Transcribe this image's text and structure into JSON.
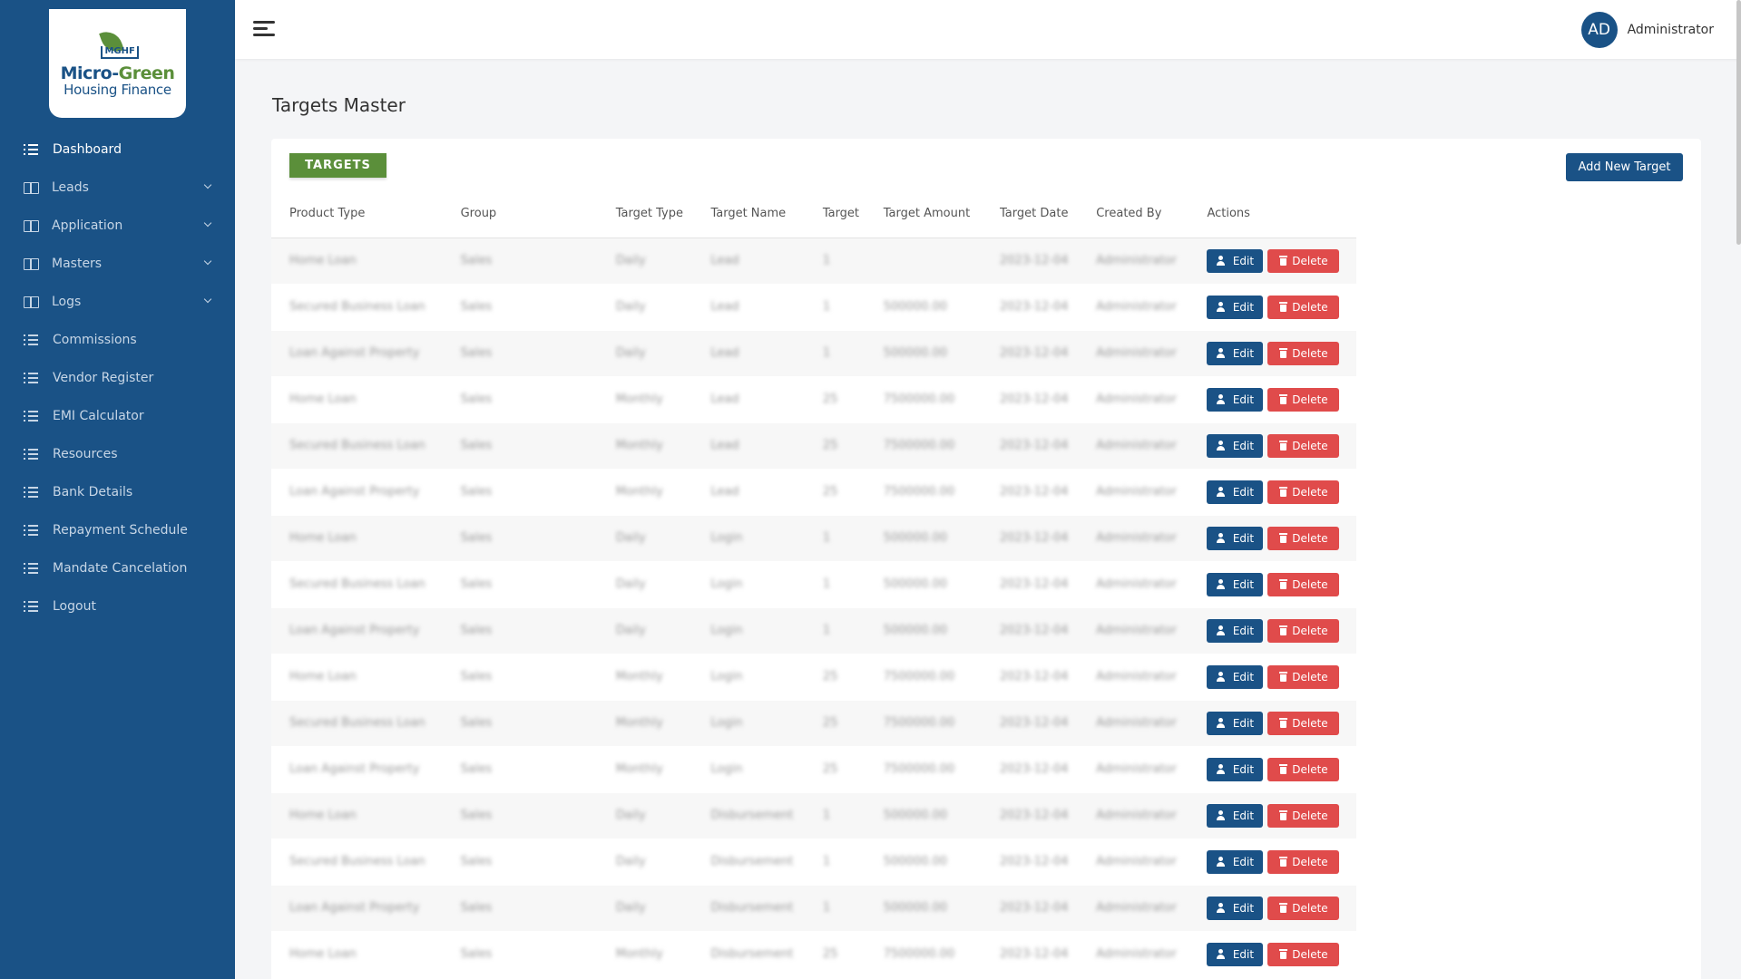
{
  "logo": {
    "word1": "Micro-",
    "word2": "Green",
    "line2": "Housing Finance",
    "badge": "MGHF"
  },
  "sidebar": {
    "items": [
      {
        "label": "Dashboard",
        "icon": "list-icon",
        "chevron": false
      },
      {
        "label": "Leads",
        "icon": "book-icon",
        "chevron": true
      },
      {
        "label": "Application",
        "icon": "book-icon",
        "chevron": true
      },
      {
        "label": "Masters",
        "icon": "book-icon",
        "chevron": true
      },
      {
        "label": "Logs",
        "icon": "book-icon",
        "chevron": true
      },
      {
        "label": "Commissions",
        "icon": "list-icon",
        "chevron": false
      },
      {
        "label": "Vendor Register",
        "icon": "list-icon",
        "chevron": false
      },
      {
        "label": "EMI Calculator",
        "icon": "list-icon",
        "chevron": false
      },
      {
        "label": "Resources",
        "icon": "list-icon",
        "chevron": false
      },
      {
        "label": "Bank Details",
        "icon": "list-icon",
        "chevron": false
      },
      {
        "label": "Repayment Schedule",
        "icon": "list-icon",
        "chevron": false
      },
      {
        "label": "Mandate Cancelation",
        "icon": "list-icon",
        "chevron": false
      },
      {
        "label": "Logout",
        "icon": "list-icon",
        "chevron": false
      }
    ]
  },
  "header": {
    "avatar_initials": "AD",
    "user_name": "Administrator"
  },
  "page": {
    "title": "Targets Master",
    "tag": "TARGETS",
    "add_button": "Add New Target"
  },
  "table": {
    "columns": [
      "Product Type",
      "Group",
      "Target Type",
      "Target Name",
      "Target",
      "Target Amount",
      "Target Date",
      "Created By",
      "Actions"
    ],
    "edit_label": "Edit",
    "delete_label": "Delete",
    "rows": [
      [
        "Home Loan",
        "Sales",
        "Daily",
        "Lead",
        "1",
        "",
        "2023-12-04",
        "Administrator"
      ],
      [
        "Secured Business Loan",
        "Sales",
        "Daily",
        "Lead",
        "1",
        "500000.00",
        "2023-12-04",
        "Administrator"
      ],
      [
        "Loan Against Property",
        "Sales",
        "Daily",
        "Lead",
        "1",
        "500000.00",
        "2023-12-04",
        "Administrator"
      ],
      [
        "Home Loan",
        "Sales",
        "Monthly",
        "Lead",
        "25",
        "7500000.00",
        "2023-12-04",
        "Administrator"
      ],
      [
        "Secured Business Loan",
        "Sales",
        "Monthly",
        "Lead",
        "25",
        "7500000.00",
        "2023-12-04",
        "Administrator"
      ],
      [
        "Loan Against Property",
        "Sales",
        "Monthly",
        "Lead",
        "25",
        "7500000.00",
        "2023-12-04",
        "Administrator"
      ],
      [
        "Home Loan",
        "Sales",
        "Daily",
        "Login",
        "1",
        "500000.00",
        "2023-12-04",
        "Administrator"
      ],
      [
        "Secured Business Loan",
        "Sales",
        "Daily",
        "Login",
        "1",
        "500000.00",
        "2023-12-04",
        "Administrator"
      ],
      [
        "Loan Against Property",
        "Sales",
        "Daily",
        "Login",
        "1",
        "500000.00",
        "2023-12-04",
        "Administrator"
      ],
      [
        "Home Loan",
        "Sales",
        "Monthly",
        "Login",
        "25",
        "7500000.00",
        "2023-12-04",
        "Administrator"
      ],
      [
        "Secured Business Loan",
        "Sales",
        "Monthly",
        "Login",
        "25",
        "7500000.00",
        "2023-12-04",
        "Administrator"
      ],
      [
        "Loan Against Property",
        "Sales",
        "Monthly",
        "Login",
        "25",
        "7500000.00",
        "2023-12-04",
        "Administrator"
      ],
      [
        "Home Loan",
        "Sales",
        "Daily",
        "Disbursement",
        "1",
        "500000.00",
        "2023-12-04",
        "Administrator"
      ],
      [
        "Secured Business Loan",
        "Sales",
        "Daily",
        "Disbursement",
        "1",
        "500000.00",
        "2023-12-04",
        "Administrator"
      ],
      [
        "Loan Against Property",
        "Sales",
        "Daily",
        "Disbursement",
        "1",
        "500000.00",
        "2023-12-04",
        "Administrator"
      ],
      [
        "Home Loan",
        "Sales",
        "Monthly",
        "Disbursement",
        "25",
        "7500000.00",
        "2023-12-04",
        "Administrator"
      ]
    ]
  },
  "colors": {
    "primary": "#1a5286",
    "accent_green": "#5b8f3a",
    "danger": "#e04b4b"
  }
}
